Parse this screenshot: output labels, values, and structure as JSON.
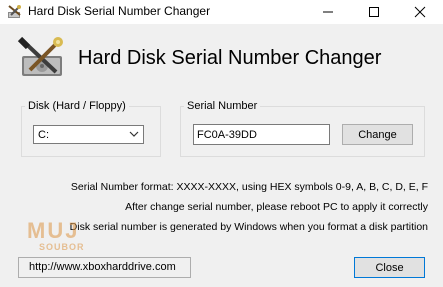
{
  "window": {
    "title": "Hard Disk Serial Number Changer",
    "icons": [
      "app-icon",
      "minimize-icon",
      "maximize-icon",
      "close-icon"
    ]
  },
  "header": {
    "title": "Hard Disk Serial Number Changer",
    "icon": "tools-disk-icon"
  },
  "disk_group": {
    "label": "Disk (Hard / Floppy)",
    "selected": "C:"
  },
  "serial_group": {
    "label": "Serial Number",
    "value": "FC0A-39DD",
    "change_label": "Change"
  },
  "info": {
    "line1": "Serial Number format: XXXX-XXXX, using HEX symbols 0-9, A, B, C, D, E, F",
    "line2": "After change serial number, please reboot PC to apply it correctly",
    "line3": "Disk serial number is generated by Windows when you format a disk partition"
  },
  "watermark": {
    "big": "MUJ",
    "small": "SOUBOR"
  },
  "footer": {
    "url": "http://www.xboxharddrive.com",
    "close_label": "Close"
  },
  "colors": {
    "accent": "#0078d7",
    "button_face": "#e1e1e1",
    "window_bg": "#f0f0f0"
  }
}
